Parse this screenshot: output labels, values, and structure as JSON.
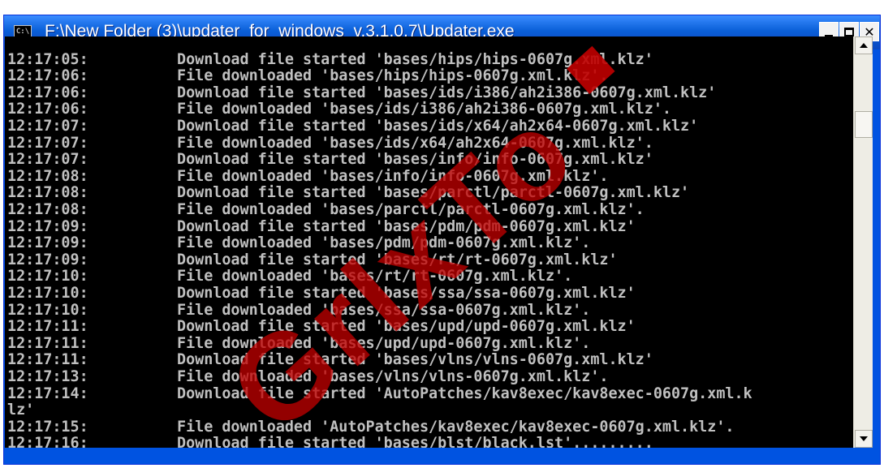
{
  "window": {
    "title": "F:\\New Folder (3)\\updater_for_windows_v.3.1.0.7\\Updater.exe",
    "icon_label": "C:\\",
    "icon": "console-icon",
    "buttons": {
      "minimize": "minimize-icon",
      "maximize": "maximize-icon",
      "close": "✕"
    }
  },
  "console": {
    "colors": {
      "background": "#000000",
      "text": "#c0c0c0"
    },
    "lines": [
      {
        "time": "12:17:05:",
        "msg": "Download file started 'bases/hips/hips-0607g.xml.klz'"
      },
      {
        "time": "12:17:06:",
        "msg": "File downloaded 'bases/hips/hips-0607g.xml.klz'."
      },
      {
        "time": "12:17:06:",
        "msg": "Download file started 'bases/ids/i386/ah2i386-0607g.xml.klz'"
      },
      {
        "time": "12:17:06:",
        "msg": "File downloaded 'bases/ids/i386/ah2i386-0607g.xml.klz'."
      },
      {
        "time": "12:17:07:",
        "msg": "Download file started 'bases/ids/x64/ah2x64-0607g.xml.klz'"
      },
      {
        "time": "12:17:07:",
        "msg": "File downloaded 'bases/ids/x64/ah2x64-0607g.xml.klz'."
      },
      {
        "time": "12:17:07:",
        "msg": "Download file started 'bases/info/info-0607g.xml.klz'"
      },
      {
        "time": "12:17:08:",
        "msg": "File downloaded 'bases/info/info-0607g.xml.klz'."
      },
      {
        "time": "12:17:08:",
        "msg": "Download file started 'bases/parctl/parctl-0607g.xml.klz'"
      },
      {
        "time": "12:17:08:",
        "msg": "File downloaded 'bases/parctl/parctl-0607g.xml.klz'."
      },
      {
        "time": "12:17:09:",
        "msg": "Download file started 'bases/pdm/pdm-0607g.xml.klz'"
      },
      {
        "time": "12:17:09:",
        "msg": "File downloaded 'bases/pdm/pdm-0607g.xml.klz'."
      },
      {
        "time": "12:17:09:",
        "msg": "Download file started 'bases/rt/rt-0607g.xml.klz'"
      },
      {
        "time": "12:17:10:",
        "msg": "File downloaded 'bases/rt/rt-0607g.xml.klz'."
      },
      {
        "time": "12:17:10:",
        "msg": "Download file started 'bases/ssa/ssa-0607g.xml.klz'"
      },
      {
        "time": "12:17:10:",
        "msg": "File downloaded 'bases/ssa/ssa-0607g.xml.klz'."
      },
      {
        "time": "12:17:11:",
        "msg": "Download file started 'bases/upd/upd-0607g.xml.klz'"
      },
      {
        "time": "12:17:11:",
        "msg": "File downloaded 'bases/upd/upd-0607g.xml.klz'."
      },
      {
        "time": "12:17:11:",
        "msg": "Download file started 'bases/vlns/vlns-0607g.xml.klz'"
      },
      {
        "time": "12:17:13:",
        "msg": "File downloaded 'bases/vlns/vlns-0607g.xml.klz'."
      },
      {
        "time": "12:17:14:",
        "msg": "Download file started 'AutoPatches/kav8exec/kav8exec-0607g.xml.k"
      },
      {
        "time": "lz'",
        "msg": ""
      },
      {
        "time": "12:17:15:",
        "msg": "File downloaded 'AutoPatches/kav8exec/kav8exec-0607g.xml.klz'."
      },
      {
        "time": "12:17:16:",
        "msg": "Download file started 'bases/blst/black.lst'........."
      }
    ]
  },
  "scrollbar": {
    "up": "scroll-up-arrow-icon",
    "down": "scroll-down-arrow-icon"
  }
}
